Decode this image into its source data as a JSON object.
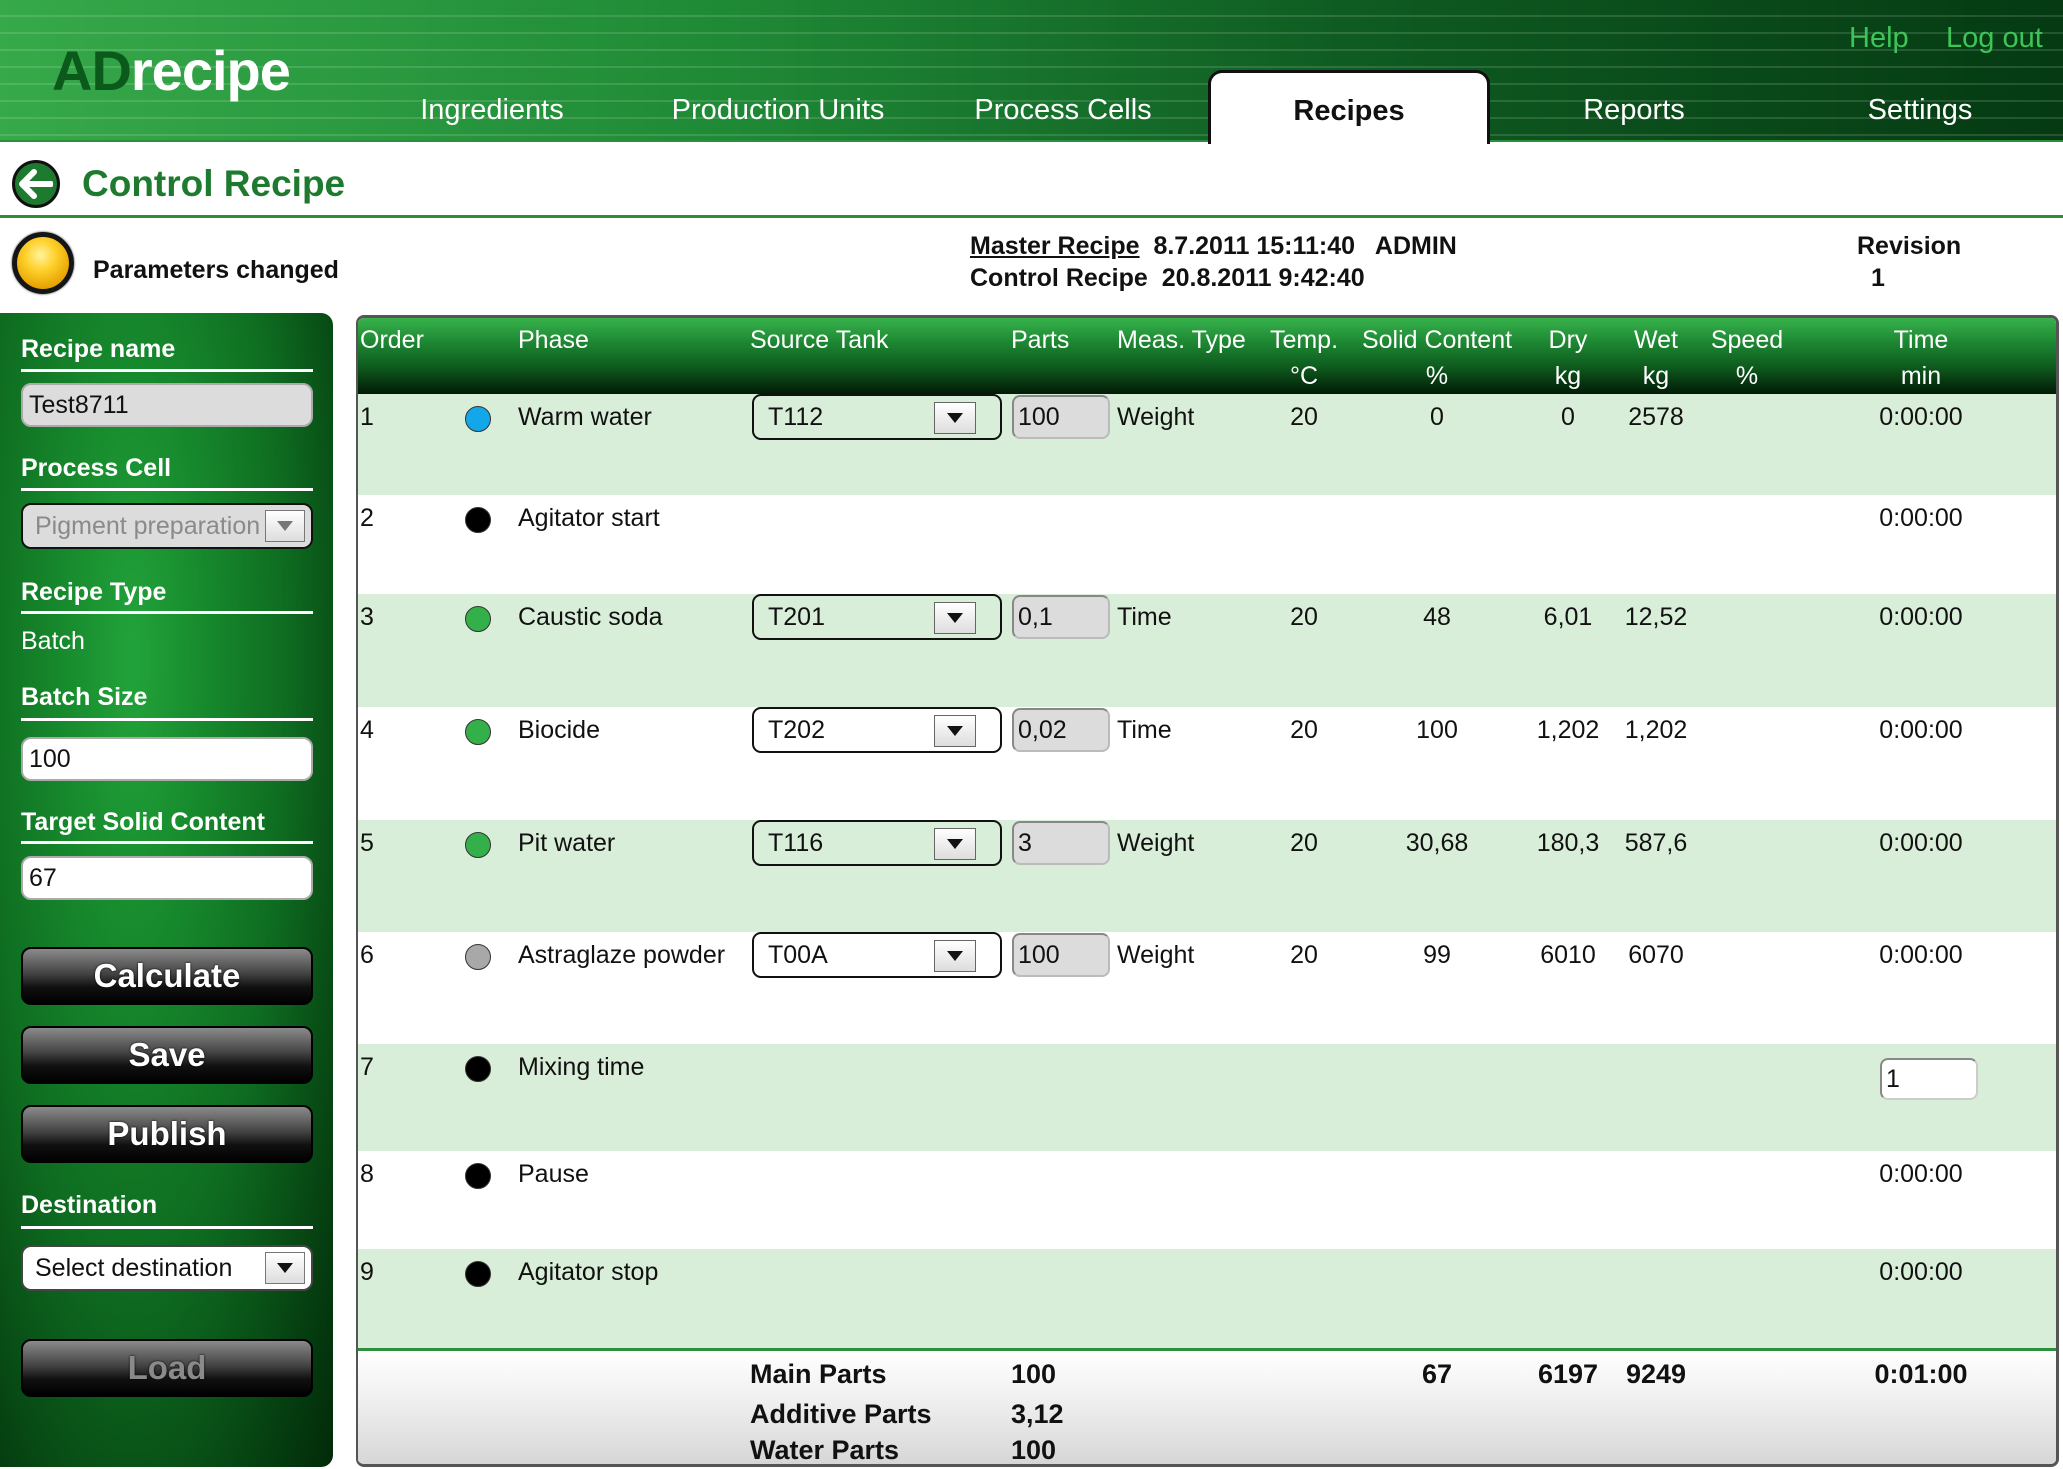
{
  "app": {
    "logo_part1": "AD",
    "logo_part2": "recipe",
    "help": "Help",
    "logout": "Log out"
  },
  "nav": {
    "tabs": [
      {
        "label": "Ingredients",
        "active": false
      },
      {
        "label": "Production Units",
        "active": false
      },
      {
        "label": "Process Cells",
        "active": false
      },
      {
        "label": "Recipes",
        "active": true
      },
      {
        "label": "Reports",
        "active": false
      },
      {
        "label": "Settings",
        "active": false
      }
    ]
  },
  "page": {
    "title": "Control Recipe",
    "status_text": "Parameters changed",
    "status_color": "#ffc20e",
    "master_recipe_label": "Master Recipe",
    "master_recipe_value": "8.7.2011 15:11:40   ADMIN",
    "control_recipe_label": "Control Recipe",
    "control_recipe_value": "20.8.2011 9:42:40",
    "revision_label": "Revision",
    "revision_value": "1"
  },
  "sidebar": {
    "recipe_name_label": "Recipe name",
    "recipe_name_value": "Test8711",
    "process_cell_label": "Process Cell",
    "process_cell_value": "Pigment preparation",
    "recipe_type_label": "Recipe Type",
    "recipe_type_value": "Batch",
    "batch_size_label": "Batch Size",
    "batch_size_value": "100",
    "target_solid_label": "Target Solid Content",
    "target_solid_value": "67",
    "calculate": "Calculate",
    "save": "Save",
    "publish": "Publish",
    "destination_label": "Destination",
    "destination_value": "Select destination",
    "load": "Load"
  },
  "table": {
    "headers": {
      "order": "Order",
      "phase": "Phase",
      "source_tank": "Source Tank",
      "parts": "Parts",
      "meas_type": "Meas. Type",
      "temp": "Temp.",
      "temp_unit": "°C",
      "solid": "Solid Content",
      "solid_unit": "%",
      "dry": "Dry",
      "dry_unit": "kg",
      "wet": "Wet",
      "wet_unit": "kg",
      "speed": "Speed",
      "speed_unit": "%",
      "time": "Time",
      "time_unit": "min"
    },
    "rows": [
      {
        "order": "1",
        "dot": "#11a7e8",
        "phase": "Warm water",
        "tank": "T112",
        "parts": "100",
        "meas": "Weight",
        "temp": "20",
        "solid": "0",
        "dry": "0",
        "wet": "2578",
        "speed": "",
        "time": "0:00:00"
      },
      {
        "order": "2",
        "dot": "#000000",
        "phase": "Agitator start",
        "tank": null,
        "parts": null,
        "meas": "",
        "temp": "",
        "solid": "",
        "dry": "",
        "wet": "",
        "speed": "",
        "time": "0:00:00"
      },
      {
        "order": "3",
        "dot": "#34b04a",
        "phase": "Caustic soda",
        "tank": "T201",
        "parts": "0,1",
        "meas": "Time",
        "temp": "20",
        "solid": "48",
        "dry": "6,01",
        "wet": "12,52",
        "speed": "",
        "time": "0:00:00"
      },
      {
        "order": "4",
        "dot": "#34b04a",
        "phase": "Biocide",
        "tank": "T202",
        "parts": "0,02",
        "meas": "Time",
        "temp": "20",
        "solid": "100",
        "dry": "1,202",
        "wet": "1,202",
        "speed": "",
        "time": "0:00:00"
      },
      {
        "order": "5",
        "dot": "#34b04a",
        "phase": "Pit water",
        "tank": "T116",
        "parts": "3",
        "meas": "Weight",
        "temp": "20",
        "solid": "30,68",
        "dry": "180,3",
        "wet": "587,6",
        "speed": "",
        "time": "0:00:00"
      },
      {
        "order": "6",
        "dot": "#a8a8a8",
        "phase": "Astraglaze powder",
        "tank": "T00A",
        "parts": "100",
        "meas": "Weight",
        "temp": "20",
        "solid": "99",
        "dry": "6010",
        "wet": "6070",
        "speed": "",
        "time": "0:00:00"
      },
      {
        "order": "7",
        "dot": "#000000",
        "phase": "Mixing time",
        "tank": null,
        "parts": null,
        "meas": "",
        "temp": "",
        "solid": "",
        "dry": "",
        "wet": "",
        "speed": "",
        "time_input": "1"
      },
      {
        "order": "8",
        "dot": "#000000",
        "phase": "Pause",
        "tank": null,
        "parts": null,
        "meas": "",
        "temp": "",
        "solid": "",
        "dry": "",
        "wet": "",
        "speed": "",
        "time": "0:00:00"
      },
      {
        "order": "9",
        "dot": "#000000",
        "phase": "Agitator stop",
        "tank": null,
        "parts": null,
        "meas": "",
        "temp": "",
        "solid": "",
        "dry": "",
        "wet": "",
        "speed": "",
        "time": "0:00:00"
      }
    ],
    "footer": {
      "main_parts_label": "Main Parts",
      "main_parts_value": "100",
      "additive_parts_label": "Additive Parts",
      "additive_parts_value": "3,12",
      "water_parts_label": "Water Parts",
      "water_parts_value": "100",
      "solid_total": "67",
      "dry_total": "6197",
      "wet_total": "9249",
      "time_total": "0:01:00"
    }
  }
}
